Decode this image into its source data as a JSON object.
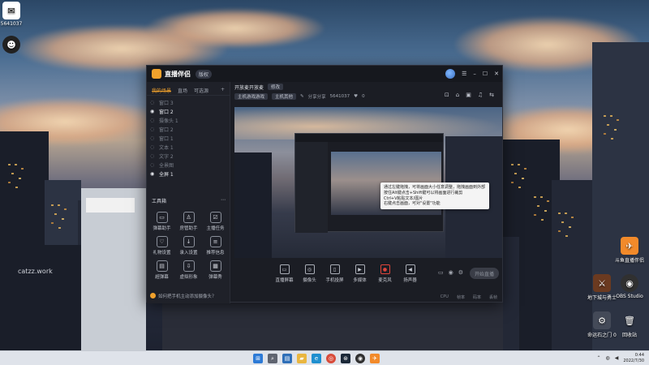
{
  "desktop": {
    "icons_left": [
      {
        "label": "5641037",
        "icon": "app-icon"
      },
      {
        "label": "",
        "icon": "app-icon"
      }
    ],
    "icons_right": [
      {
        "label": "斗鱼直播伴侣",
        "icon": "douyu-icon"
      },
      {
        "label": "地下城与勇士",
        "icon": "game-icon"
      },
      {
        "label": "OBS Studio",
        "icon": "obs-icon"
      },
      {
        "label": "命运石之门 0",
        "icon": "game-icon"
      },
      {
        "label": "回收站",
        "icon": "recycle-bin-icon"
      }
    ],
    "background_text": "catzz.work"
  },
  "app": {
    "name": "直播伴侣",
    "version": "版权",
    "sidebar": {
      "tabs": [
        "我的场景",
        "直场",
        "可选源"
      ],
      "scenes": [
        {
          "label": "窗口 3",
          "active": false
        },
        {
          "label": "窗口 2",
          "active": true
        },
        {
          "label": "摄像头 1",
          "active": false
        },
        {
          "label": "窗口 2",
          "active": false
        },
        {
          "label": "窗口 1",
          "active": false
        },
        {
          "label": "文本 1",
          "active": false
        },
        {
          "label": "文字 2",
          "active": false
        },
        {
          "label": "全景图",
          "active": false
        },
        {
          "label": "全屏 1",
          "active": true
        }
      ],
      "tools_title": "工具箱",
      "tools": [
        {
          "label": "弹幕助手",
          "icon": "chat-icon"
        },
        {
          "label": "房管助手",
          "icon": "user-icon"
        },
        {
          "label": "主播任务",
          "icon": "task-icon"
        },
        {
          "label": "礼物设置",
          "icon": "gift-icon"
        },
        {
          "label": "录入设置",
          "icon": "download-icon"
        },
        {
          "label": "推荐信息",
          "icon": "info-icon"
        },
        {
          "label": "超弹幕",
          "icon": "bullet-icon"
        },
        {
          "label": "虚拟形象",
          "icon": "avatar-icon"
        },
        {
          "label": "弹幕秀",
          "icon": "show-icon"
        }
      ],
      "hint": "如何把手机主动添加摄像头？"
    },
    "main": {
      "stream_title": "开放麦开放麦",
      "stream_tag": "修改",
      "category_a": "主机游戏游戏",
      "category_b": "主机其他",
      "room_label": "分享分享",
      "room_id": "5641037",
      "likes": "0",
      "controls": [
        "直播屏幕",
        "摄像头",
        "手机投屏",
        "多媒体",
        "麦克风",
        "扬声器"
      ],
      "go_live": "开始直播",
      "stats": [
        "CPU",
        "帧率",
        "码率",
        "丢帧"
      ],
      "tooltip_lines": [
        "通过左键拖拽，可将画面大小任意调整，拖拽画面到外部",
        "按住Alt键点击+Shift键可以将画面进行裁剪",
        "Ctrl+V粘贴文本/图片",
        "右键点击画面，可对\"设置\"功能"
      ]
    }
  },
  "taskbar": {
    "apps": [
      "windows-icon",
      "search-icon",
      "widgets-icon",
      "explorer-icon",
      "edge-icon",
      "chrome-icon",
      "steam-icon",
      "obs-icon",
      "douyu-icon"
    ],
    "time": "0:44",
    "date": "2022/7/30"
  }
}
